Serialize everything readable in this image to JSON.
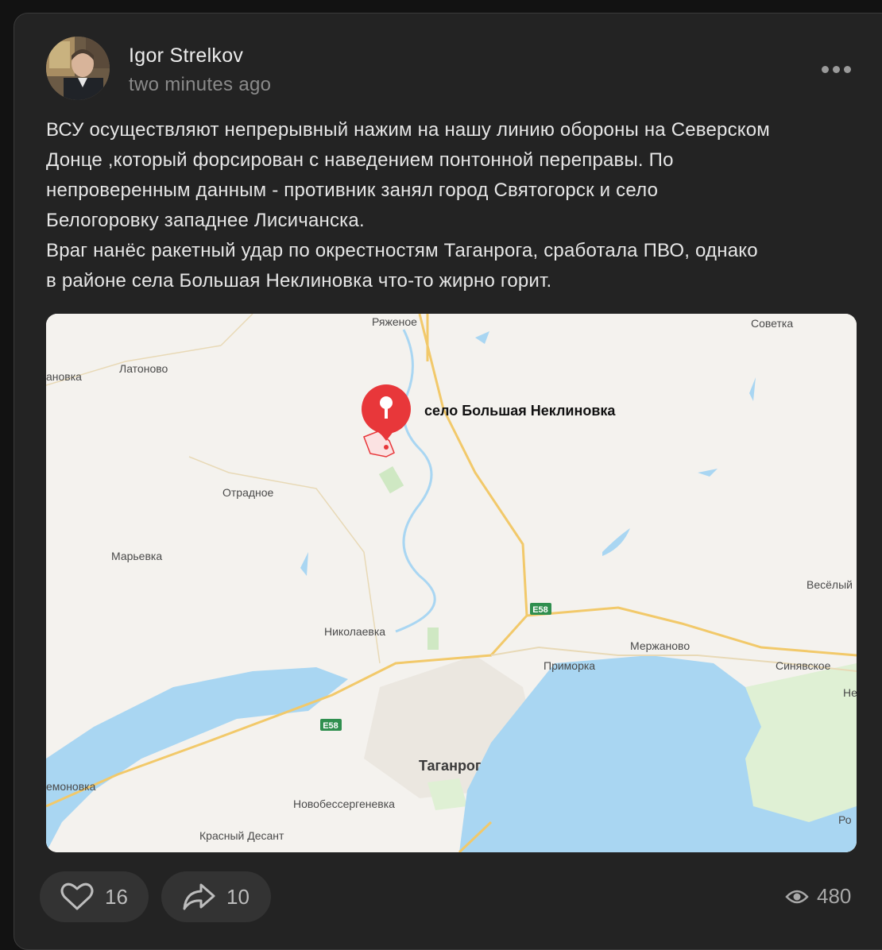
{
  "post": {
    "author": "Igor Strelkov",
    "time": "two minutes ago",
    "lines": [
      "ВСУ осуществляют непрерывный нажим на нашу линию обороны на Северском",
      "Донце ,который форсирован с наведением понтонной переправы. По",
      "непроверенным данным - противник занял город Святогорск и село",
      "Белогоровку западнее Лисичанска.",
      "Враг нанёс ракетный удар по окрестностям Таганрога, сработала ПВО, однако",
      "в районе села Большая Неклиновка что-то жирно горит."
    ]
  },
  "map": {
    "pin_label": "село Большая Неклиновка",
    "city": "Таганрог",
    "road_badge": "E58",
    "labels": {
      "ryazhenoe": "Ряженое",
      "sovetka": "Советка",
      "anovka": "ановка",
      "latonovo": "Латоново",
      "otradnoe": "Отрадное",
      "maryevka": "Марьевка",
      "veselyi": "Весёлый",
      "nikolaevka": "Николаевка",
      "merzhanovo": "Мержаново",
      "primorka": "Приморка",
      "sinyavskoe": "Синявское",
      "ne": "Не",
      "emonovka": "емоновка",
      "novobessergenevka": "Новобессергеневка",
      "krasny_desant": "Красный Десант",
      "ro": "Ро"
    }
  },
  "actions": {
    "likes": "16",
    "shares": "10",
    "views": "480"
  },
  "icons": {
    "more": "more-dots-icon",
    "like": "heart-icon",
    "share": "share-arrow-icon",
    "views": "eye-icon"
  },
  "colors": {
    "background": "#121212",
    "card": "#232323",
    "pin": "#e8373a",
    "water": "#a9d6f2",
    "road": "#f2c96a"
  }
}
